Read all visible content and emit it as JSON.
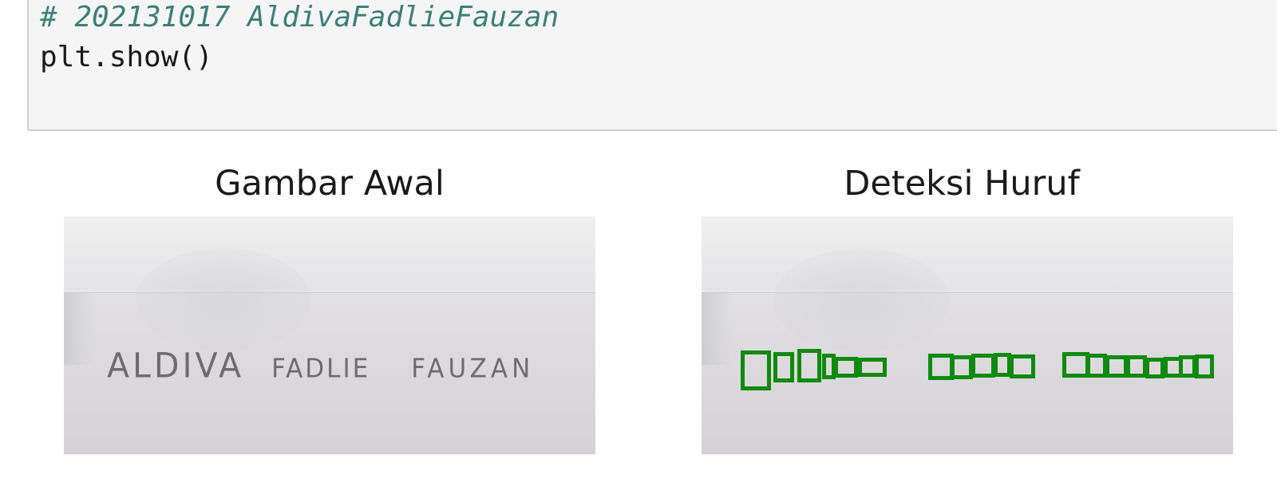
{
  "code_cell": {
    "comment_line": "# 202131017 AldivaFadlieFauzan",
    "code_line": "plt.show()"
  },
  "output": {
    "left_panel": {
      "title": "Gambar Awal",
      "handwritten_word_1": "ALDIVA",
      "handwritten_word_2": "FADLIE",
      "handwritten_word_3": "FAUZAN"
    },
    "right_panel": {
      "title": "Deteksi Huruf",
      "box_color": "#0f8a0f",
      "detected_box_count": 19
    }
  },
  "colors": {
    "comment": "#3d7f7a",
    "code": "#1a1a1a",
    "cell_background": "#f5f5f5"
  }
}
